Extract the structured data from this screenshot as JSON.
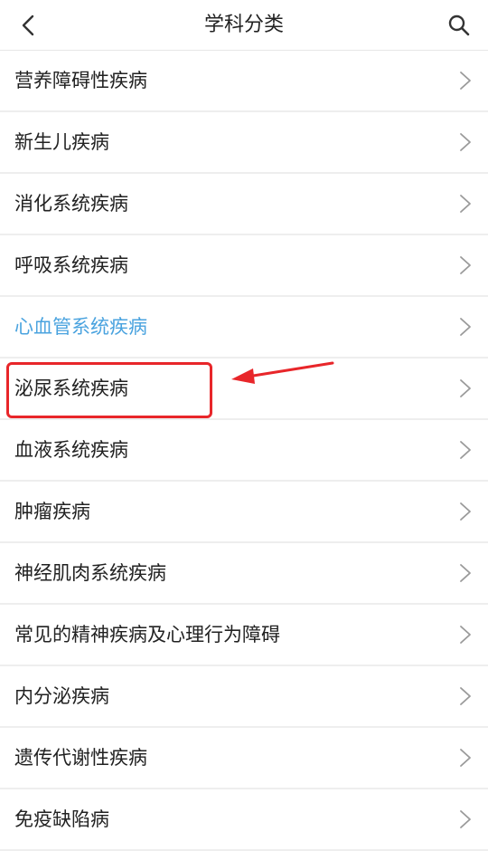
{
  "header": {
    "title": "学科分类",
    "back_icon": "chevron-left-icon",
    "search_icon": "search-icon"
  },
  "categories": [
    {
      "label": "营养障碍性疾病"
    },
    {
      "label": "新生儿疾病"
    },
    {
      "label": "消化系统疾病"
    },
    {
      "label": "呼吸系统疾病"
    },
    {
      "label": "心血管系统疾病",
      "active": true
    },
    {
      "label": "泌尿系统疾病",
      "highlighted": true
    },
    {
      "label": "血液系统疾病"
    },
    {
      "label": "肿瘤疾病"
    },
    {
      "label": "神经肌肉系统疾病"
    },
    {
      "label": "常见的精神疾病及心理行为障碍"
    },
    {
      "label": "内分泌疾病"
    },
    {
      "label": "遗传代谢性疾病"
    },
    {
      "label": "免疫缺陷病"
    }
  ],
  "colors": {
    "active_text": "#4aa3df",
    "annotation": "#e8262a",
    "text": "#222222",
    "divider": "#eeeeee"
  }
}
